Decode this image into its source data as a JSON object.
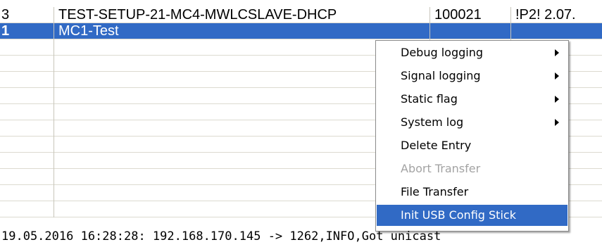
{
  "table": {
    "rows": [
      {
        "col0": "3",
        "col1": "TEST-SETUP-21-MC4-MWLCSLAVE-DHCP",
        "col2": "100021",
        "col3": "!P2! 2.07.",
        "selected": false
      },
      {
        "col0": "1",
        "col1": "MC1-Test",
        "col2": "",
        "col3": "",
        "selected": true
      },
      {
        "col0": "",
        "col1": "",
        "col2": "",
        "col3": "",
        "selected": false
      },
      {
        "col0": "",
        "col1": "",
        "col2": "",
        "col3": "",
        "selected": false
      },
      {
        "col0": "",
        "col1": "",
        "col2": "",
        "col3": "",
        "selected": false
      },
      {
        "col0": "",
        "col1": "",
        "col2": "",
        "col3": "",
        "selected": false
      },
      {
        "col0": "",
        "col1": "",
        "col2": "",
        "col3": "",
        "selected": false
      },
      {
        "col0": "",
        "col1": "",
        "col2": "",
        "col3": "",
        "selected": false
      },
      {
        "col0": "",
        "col1": "",
        "col2": "",
        "col3": "",
        "selected": false
      },
      {
        "col0": "",
        "col1": "",
        "col2": "",
        "col3": "",
        "selected": false
      },
      {
        "col0": "",
        "col1": "",
        "col2": "",
        "col3": "",
        "selected": false
      },
      {
        "col0": "",
        "col1": "",
        "col2": "",
        "col3": "",
        "selected": false
      },
      {
        "col0": "",
        "col1": "",
        "col2": "",
        "col3": "",
        "selected": false
      }
    ]
  },
  "context_menu": {
    "items": [
      {
        "label": "Debug logging",
        "submenu": true,
        "disabled": false,
        "highlighted": false,
        "name": "menu-item-debug-logging"
      },
      {
        "label": "Signal logging",
        "submenu": true,
        "disabled": false,
        "highlighted": false,
        "name": "menu-item-signal-logging"
      },
      {
        "label": "Static flag",
        "submenu": true,
        "disabled": false,
        "highlighted": false,
        "name": "menu-item-static-flag"
      },
      {
        "label": "System log",
        "submenu": true,
        "disabled": false,
        "highlighted": false,
        "name": "menu-item-system-log"
      },
      {
        "label": "Delete Entry",
        "submenu": false,
        "disabled": false,
        "highlighted": false,
        "name": "menu-item-delete-entry"
      },
      {
        "label": "Abort Transfer",
        "submenu": false,
        "disabled": true,
        "highlighted": false,
        "name": "menu-item-abort-transfer"
      },
      {
        "label": "File Transfer",
        "submenu": false,
        "disabled": false,
        "highlighted": false,
        "name": "menu-item-file-transfer"
      },
      {
        "label": "Init USB Config Stick",
        "submenu": false,
        "disabled": false,
        "highlighted": true,
        "name": "menu-item-init-usb-config-stick"
      }
    ]
  },
  "log": {
    "line": "19.05.2016 16:28:28: 192.168.170.145 -> 1262,INFO,Got unicast"
  },
  "colors": {
    "selection": "#316ac5",
    "gridline": "#dcdad0",
    "disabled_text": "#a3a3a3"
  }
}
